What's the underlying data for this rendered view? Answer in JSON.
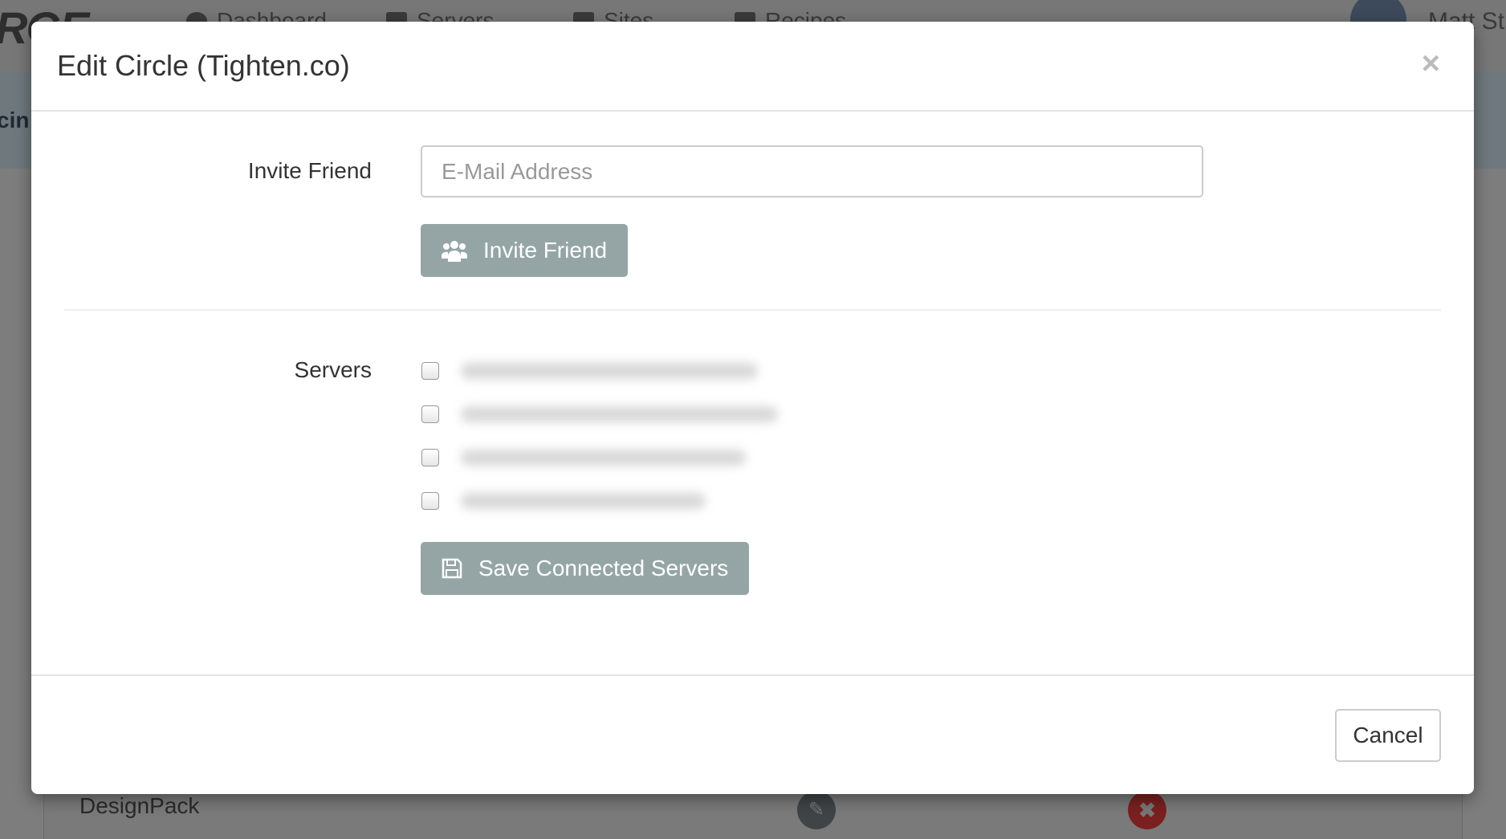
{
  "background": {
    "logo": "RGE",
    "nav": [
      {
        "label": "Dashboard",
        "icon": "dashboard-icon"
      },
      {
        "label": "Servers",
        "icon": "servers-icon"
      },
      {
        "label": "Sites",
        "icon": "edit-icon"
      },
      {
        "label": "Recipes",
        "icon": "book-icon"
      }
    ],
    "user_name": "Matt St",
    "band_text": "cin",
    "row_name": "DesignPack"
  },
  "modal": {
    "title": "Edit Circle (Tighten.co)",
    "close_label": "×",
    "invite": {
      "label": "Invite Friend",
      "placeholder": "E-Mail Address",
      "button_label": "Invite Friend",
      "button_icon": "users-icon"
    },
    "servers": {
      "label": "Servers",
      "items": [
        {
          "checked": false
        },
        {
          "checked": false
        },
        {
          "checked": false
        },
        {
          "checked": false
        }
      ],
      "button_label": "Save Connected Servers",
      "button_icon": "floppy-disk-icon"
    },
    "cancel_label": "Cancel"
  },
  "colors": {
    "button": "#95a5a6",
    "overlay": "#7d7d7d"
  }
}
